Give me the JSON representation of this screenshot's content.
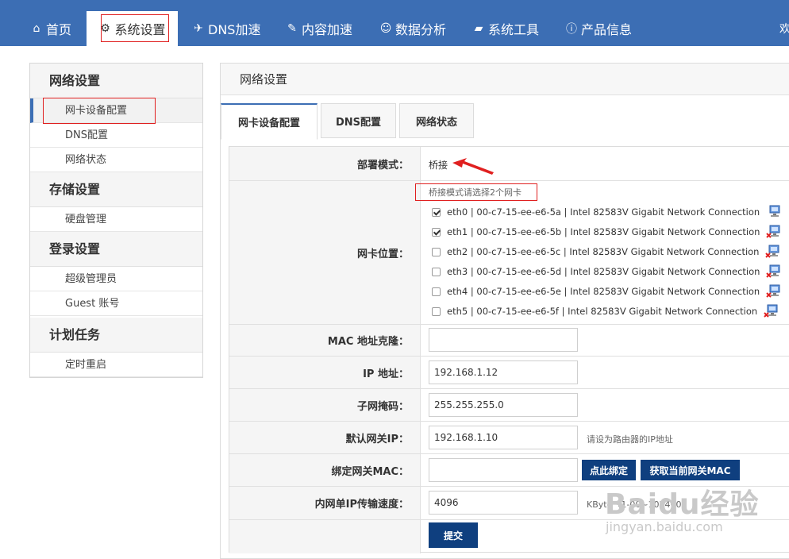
{
  "nav": {
    "items": [
      {
        "label": "首页",
        "icon": "home-icon",
        "glyph": "⌂"
      },
      {
        "label": "系统设置",
        "icon": "gears-icon",
        "glyph": "⚙"
      },
      {
        "label": "DNS加速",
        "icon": "paper-plane-icon",
        "glyph": "✈"
      },
      {
        "label": "内容加速",
        "icon": "edit-icon",
        "glyph": "✎"
      },
      {
        "label": "数据分析",
        "icon": "user-chart-icon",
        "glyph": "☺"
      },
      {
        "label": "系统工具",
        "icon": "briefcase-icon",
        "glyph": "▰"
      },
      {
        "label": "产品信息",
        "icon": "info-circle-icon",
        "glyph": "ⓘ"
      }
    ],
    "welcome": "欢"
  },
  "sidebar": {
    "groups": [
      {
        "title": "网络设置",
        "items": [
          "网卡设备配置",
          "DNS配置",
          "网络状态"
        ]
      },
      {
        "title": "存储设置",
        "items": [
          "硬盘管理"
        ]
      },
      {
        "title": "登录设置",
        "items": [
          "超级管理员",
          "Guest 账号"
        ]
      },
      {
        "title": "计划任务",
        "items": [
          "定时重启"
        ]
      }
    ]
  },
  "panel": {
    "title": "网络设置",
    "tabs": [
      "网卡设备配置",
      "DNS配置",
      "网络状态"
    ]
  },
  "form": {
    "deploy_label": "部署模式：",
    "deploy_value": "桥接",
    "nic_label": "网卡位置：",
    "nic_hint": "桥接模式请选择2个网卡",
    "nics": [
      {
        "label": "eth0 | 00-c7-15-ee-e6-5a | Intel 82583V Gigabit Network Connection",
        "checked": true,
        "connected": true
      },
      {
        "label": "eth1 | 00-c7-15-ee-e6-5b | Intel 82583V Gigabit Network Connection",
        "checked": true,
        "connected": false
      },
      {
        "label": "eth2 | 00-c7-15-ee-e6-5c | Intel 82583V Gigabit Network Connection",
        "checked": false,
        "connected": false
      },
      {
        "label": "eth3 | 00-c7-15-ee-e6-5d | Intel 82583V Gigabit Network Connection",
        "checked": false,
        "connected": false
      },
      {
        "label": "eth4 | 00-c7-15-ee-e6-5e | Intel 82583V Gigabit Network Connection",
        "checked": false,
        "connected": false
      },
      {
        "label": "eth5 | 00-c7-15-ee-e6-5f | Intel 82583V Gigabit Network Connection",
        "checked": false,
        "connected": false
      }
    ],
    "mac_clone_label": "MAC 地址克隆：",
    "mac_clone_value": "",
    "ip_label": "IP 地址：",
    "ip_value": "192.168.1.12",
    "mask_label": "子网掩码：",
    "mask_value": "255.255.255.0",
    "gateway_label": "默认网关IP：",
    "gateway_value": "192.168.1.10",
    "gateway_hint": "请设为路由器的IP地址",
    "bind_mac_label": "绑定网关MAC：",
    "bind_mac_value": "",
    "bind_button": "点此绑定",
    "fetch_mac_button": "获取当前网关MAC",
    "speed_label": "内网单IP传输速度：",
    "speed_value": "4096",
    "speed_hint": "KByte（1-00~102400）",
    "submit_button": "提交"
  },
  "watermark": {
    "brand": "Baidu经验",
    "url": "jingyan.baidu.com"
  },
  "colors": {
    "nav_bg": "#3c6eb4",
    "button_bg": "#0f3f7f",
    "annotation_red": "#e02020"
  }
}
